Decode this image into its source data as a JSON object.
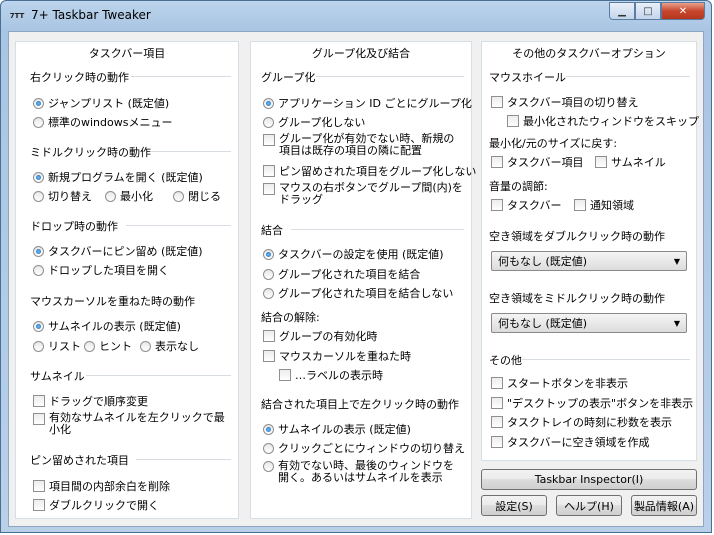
{
  "window": {
    "title": "7+ Taskbar Tweaker",
    "icon": "7TT"
  },
  "col1": {
    "title": "タスクバー項目",
    "right_click": {
      "label": "右クリック時の動作",
      "opt1": "ジャンプリスト (既定値)",
      "opt2": "標準のwindowsメニュー"
    },
    "middle_click": {
      "label": "ミドルクリック時の動作",
      "opt1": "新規プログラムを開く (既定値)",
      "opt2": "切り替え",
      "opt3": "最小化",
      "opt4": "閉じる"
    },
    "drop": {
      "label": "ドロップ時の動作",
      "opt1": "タスクバーにピン留め (既定値)",
      "opt2": "ドロップした項目を開く"
    },
    "hover": {
      "label": "マウスカーソルを重ねた時の動作",
      "opt1": "サムネイルの表示 (既定値)",
      "opt2": "リスト",
      "opt3": "ヒント",
      "opt4": "表示なし"
    },
    "thumb": {
      "label": "サムネイル",
      "opt1": "ドラッグで順序変更",
      "opt2": "有効なサムネイルを左クリックで最小化"
    },
    "pinned": {
      "label": "ピン留めされた項目",
      "opt1": "項目間の内部余白を削除",
      "opt2": "ダブルクリックで開く"
    }
  },
  "col2": {
    "title": "グループ化及び結合",
    "grouping": {
      "label": "グループ化",
      "opt1": "アプリケーション ID ごとにグループ化",
      "opt2": "グループ化しない",
      "chk1": "グループ化が有効でない時、新規の項目は既存の項目の隣に配置",
      "chk2": "ピン留めされた項目をグループ化しない",
      "chk3": "マウスの右ボタンでグループ間(内)をドラッグ"
    },
    "combine": {
      "label": "結合",
      "opt1": "タスクバーの設定を使用 (既定値)",
      "opt2": "グループ化された項目を結合",
      "opt3": "グループ化された項目を結合しない"
    },
    "uncombine": {
      "label": "結合の解除:",
      "chk1": "グループの有効化時",
      "chk2": "マウスカーソルを重ねた時",
      "chk3": "…ラベルの表示時"
    },
    "combined_left": {
      "label": "結合された項目上で左クリック時の動作",
      "opt1": "サムネイルの表示 (既定値)",
      "opt2": "クリックごとにウィンドウの切り替え",
      "opt3": "有効でない時、最後のウィンドウを開く。あるいはサムネイルを表示"
    }
  },
  "col3": {
    "title": "その他のタスクバーオプション",
    "wheel": {
      "label": "マウスホイール",
      "chk1": "タスクバー項目の切り替え",
      "chk2": "最小化されたウィンドウをスキップ"
    },
    "minmax": {
      "label": "最小化/元のサイズに戻す:",
      "chk1": "タスクバー項目",
      "chk2": "サムネイル"
    },
    "volume": {
      "label": "音量の調節:",
      "chk1": "タスクバー",
      "chk2": "通知領域"
    },
    "dbl": {
      "label": "空き領域をダブルクリック時の動作",
      "value": "何もなし (既定値)"
    },
    "mid": {
      "label": "空き領域をミドルクリック時の動作",
      "value": "何もなし (既定値)"
    },
    "other": {
      "label": "その他",
      "chk1": "スタートボタンを非表示",
      "chk2": "\"デスクトップの表示\"ボタンを非表示",
      "chk3": "タスクトレイの時刻に秒数を表示",
      "chk4": "タスクバーに空き領域を作成"
    }
  },
  "buttons": {
    "inspector": "Taskbar Inspector(I)",
    "settings": "設定(S)",
    "help": "ヘルプ(H)",
    "about": "製品情報(A)"
  },
  "caption": {
    "minimize": "▁",
    "maximize": "□",
    "close": "✕"
  }
}
